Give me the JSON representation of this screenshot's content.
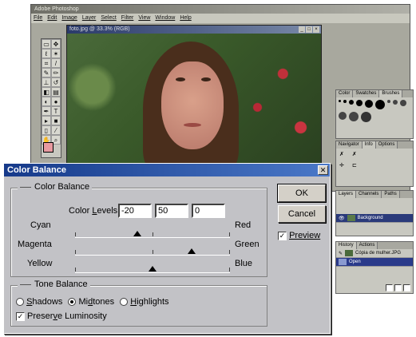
{
  "app": {
    "title": "Adobe Photoshop",
    "menu": [
      "File",
      "Edit",
      "Image",
      "Layer",
      "Select",
      "Filter",
      "View",
      "Window",
      "Help"
    ],
    "document_title": "foto.jpg @ 33.3% (RGB)"
  },
  "palettes": {
    "brushes_tabs": [
      "Color",
      "Swatches",
      "Brushes"
    ],
    "navigator_tabs": [
      "Navigator",
      "Info",
      "Options"
    ],
    "layers_tabs": [
      "Layers",
      "Channels",
      "Paths"
    ],
    "layers_item": "Background",
    "history_tabs": [
      "History",
      "Actions"
    ],
    "history_items": [
      "Cópia de mulher.JPG",
      "Open"
    ]
  },
  "dialog": {
    "title": "Color Balance",
    "color_balance_group": "Color Balance",
    "color_levels_label": "Color Levels:",
    "levels": [
      "-20",
      "50",
      "0"
    ],
    "sliders": [
      {
        "left": "Cyan",
        "right": "Red",
        "value": -20
      },
      {
        "left": "Magenta",
        "right": "Green",
        "value": 50
      },
      {
        "left": "Yellow",
        "right": "Blue",
        "value": 0
      }
    ],
    "tone_balance_group": "Tone Balance",
    "tone_options": [
      "Shadows",
      "Midtones",
      "Highlights"
    ],
    "tone_selected": "Midtones",
    "preserve_luminosity": "Preserve Luminosity",
    "preserve_checked": true,
    "ok_label": "OK",
    "cancel_label": "Cancel",
    "preview_label": "Preview",
    "preview_checked": true
  }
}
